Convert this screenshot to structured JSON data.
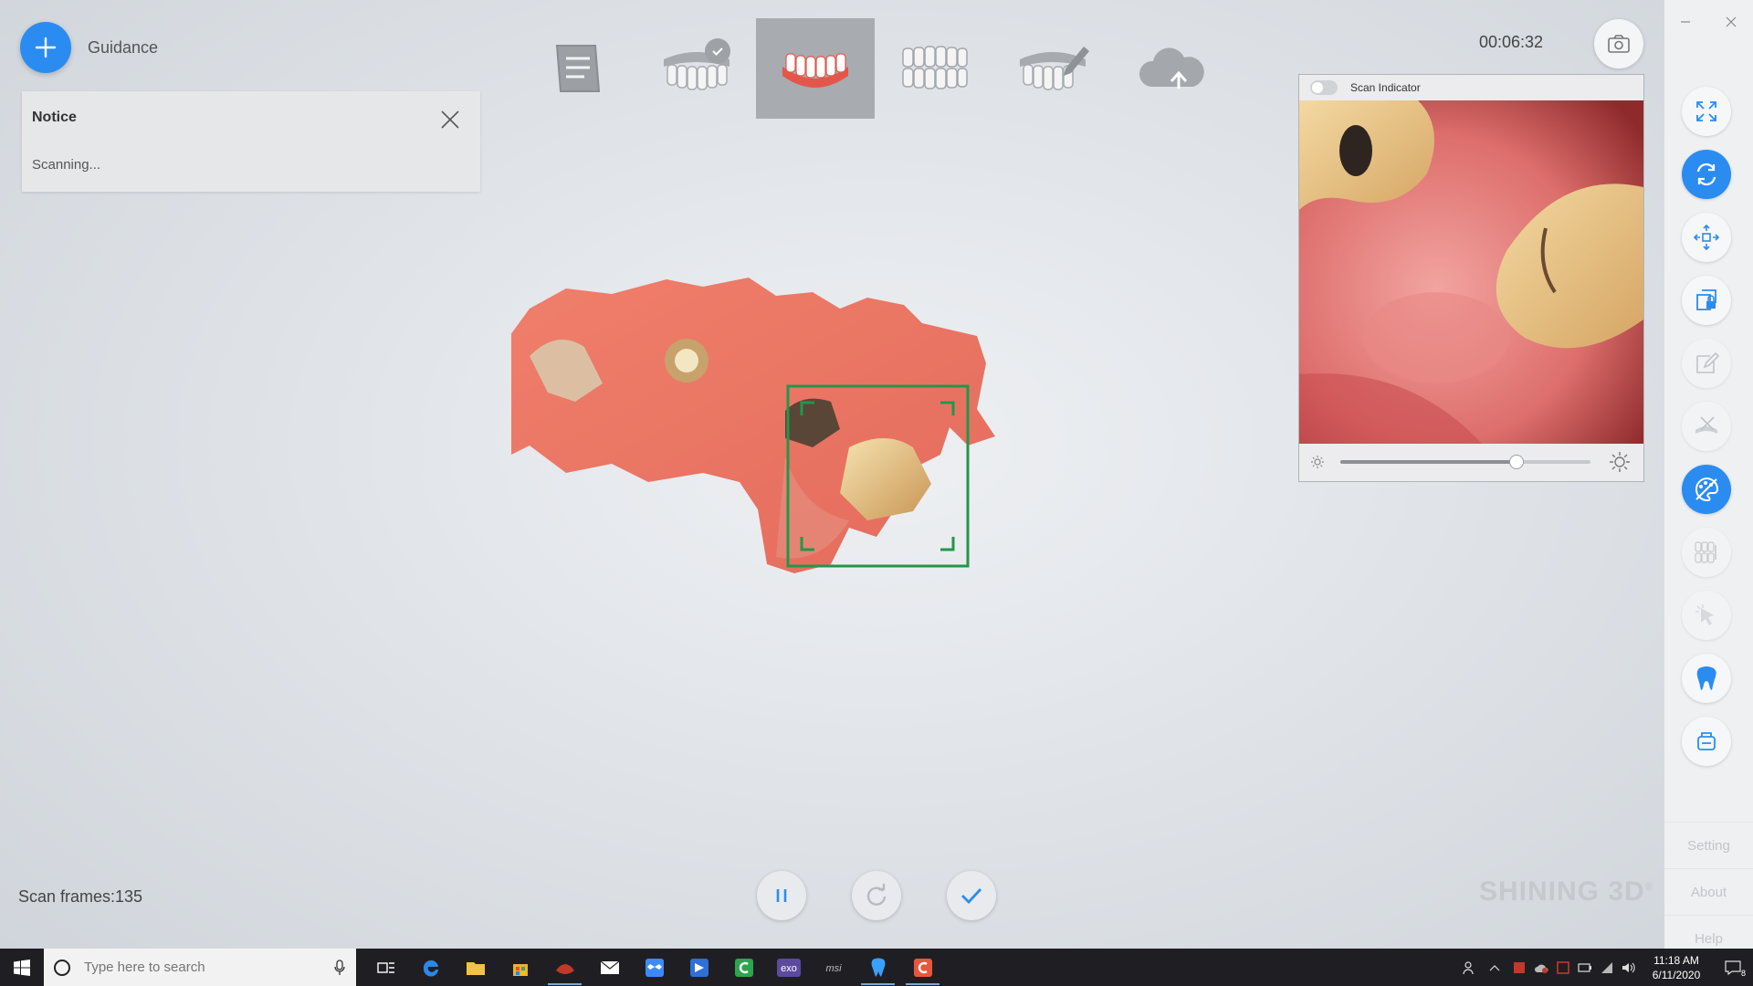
{
  "guidance": {
    "label": "Guidance"
  },
  "notice": {
    "title": "Notice",
    "message": "Scanning..."
  },
  "timer": "00:06:32",
  "scan_indicator": {
    "title": "Scan Indicator",
    "brightness_percent": 70
  },
  "scan_frames": "Scan frames:135",
  "brand": "SHINING 3D",
  "brand_mark": "®",
  "side_links": [
    "Setting",
    "About",
    "Help"
  ],
  "taskbar": {
    "search_placeholder": "Type here to search",
    "time": "11:18 AM",
    "date": "6/11/2020",
    "notification_count": "8",
    "apps": [
      "task-view-icon",
      "edge-icon",
      "file-explorer-icon",
      "store-icon",
      "app-red-icon",
      "mail-icon",
      "dropbox-icon",
      "remote-icon",
      "camtasia-icon",
      "exo-icon",
      "msi-icon",
      "dental-scan-icon",
      "app-orange-icon"
    ],
    "app_labels": {
      "exo": "exo",
      "msi": "msi"
    }
  },
  "colors": {
    "accent": "#2a8cf0",
    "frame": "#22964a",
    "gum": "#e8725e"
  }
}
